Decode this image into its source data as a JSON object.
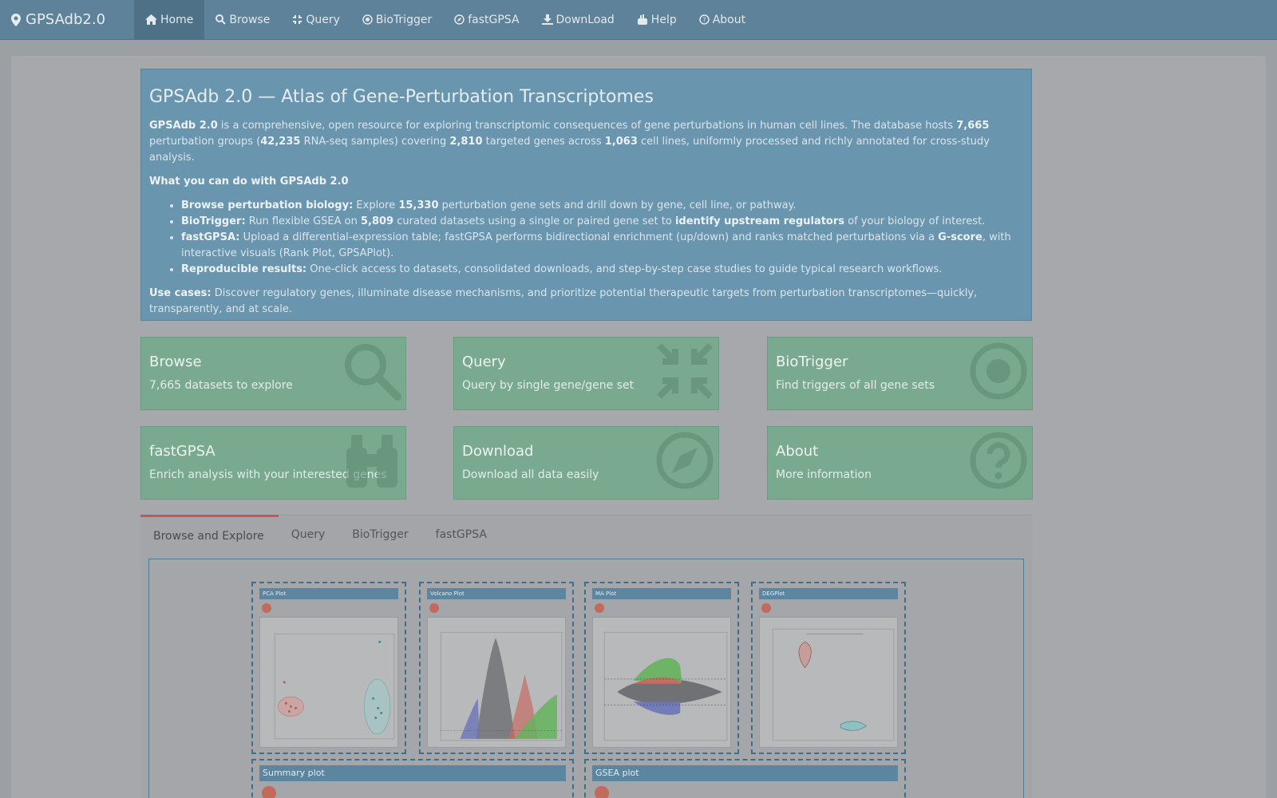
{
  "navbar": {
    "brand": "GPSAdb2.0",
    "items": [
      {
        "label": "Home",
        "icon": "home-icon",
        "active": true
      },
      {
        "label": "Browse",
        "icon": "search-icon"
      },
      {
        "label": "Query",
        "icon": "compress-icon"
      },
      {
        "label": "BioTrigger",
        "icon": "target-icon"
      },
      {
        "label": "fastGPSA",
        "icon": "compass-icon"
      },
      {
        "label": "DownLoad",
        "icon": "download-icon"
      },
      {
        "label": "Help",
        "icon": "hand-icon"
      },
      {
        "label": "About",
        "icon": "question-icon"
      }
    ]
  },
  "jumbotron": {
    "title": "GPSAdb 2.0 — Atlas of Gene-Perturbation Transcriptomes",
    "intro": {
      "name": "GPSAdb 2.0",
      "t1": " is a comprehensive, open resource for exploring transcriptomic consequences of gene perturbations in human cell lines. The database hosts ",
      "groups": "7,665",
      "t2": " perturbation groups (",
      "samples": "42,235",
      "t3": " RNA-seq samples) covering ",
      "genes": "2,810",
      "t4": " targeted genes across ",
      "cells": "1,063",
      "t5": " cell lines, uniformly processed and richly annotated for cross-study analysis."
    },
    "what_heading": "What you can do with GPSAdb 2.0",
    "b1": {
      "k": "Browse perturbation biology:",
      "t1": " Explore ",
      "n": "15,330",
      "t2": " perturbation gene sets and drill down by gene, cell line, or pathway."
    },
    "b2": {
      "k": "BioTrigger:",
      "t1": " Run flexible GSEA on ",
      "n": "5,809",
      "t2": " curated datasets using a single or paired gene set to ",
      "em": "identify upstream regulators",
      "t3": " of your biology of interest."
    },
    "b3": {
      "k": "fastGPSA:",
      "t1": " Upload a differential-expression table; fastGPSA performs bidirectional enrichment (up/down) and ranks matched perturbations via a ",
      "em": "G-score",
      "t2": ", with interactive visuals (Rank Plot, GPSAPlot)."
    },
    "b4": {
      "k": "Reproducible results:",
      "t1": " One-click access to datasets, consolidated downloads, and step-by-step case studies to guide typical research workflows."
    },
    "use": {
      "k": "Use cases:",
      "t": " Discover regulatory genes, illuminate disease mechanisms, and prioritize potential therapeutic targets from perturbation transcriptomes—quickly, transparently, and at scale."
    }
  },
  "tiles": [
    {
      "title": "Browse",
      "subtitle": "7,665 datasets to explore",
      "icon": "search-icon"
    },
    {
      "title": "Query",
      "subtitle": "Query by single gene/gene set",
      "icon": "compress-icon"
    },
    {
      "title": "BioTrigger",
      "subtitle": "Find triggers of all gene sets",
      "icon": "target-icon"
    },
    {
      "title": "fastGPSA",
      "subtitle": "Enrich analysis with your interested genes",
      "icon": "binoculars-icon"
    },
    {
      "title": "Download",
      "subtitle": "Download all data easily",
      "icon": "compass-icon"
    },
    {
      "title": "About",
      "subtitle": "More information",
      "icon": "question-icon"
    }
  ],
  "tabs": [
    "Browse and Explore",
    "Query",
    "BioTrigger",
    "fastGPSA"
  ],
  "plots": [
    "PCA Plot",
    "Volcano Plot",
    "MA Plot",
    "DEGPlot"
  ],
  "lower_plots": [
    "Summary plot",
    "GSEA plot"
  ],
  "colors": {
    "navbar": "#5e8299",
    "jumbotron": "#6996ae",
    "tile": "#79a98f",
    "tab_accent": "#c25a54"
  }
}
